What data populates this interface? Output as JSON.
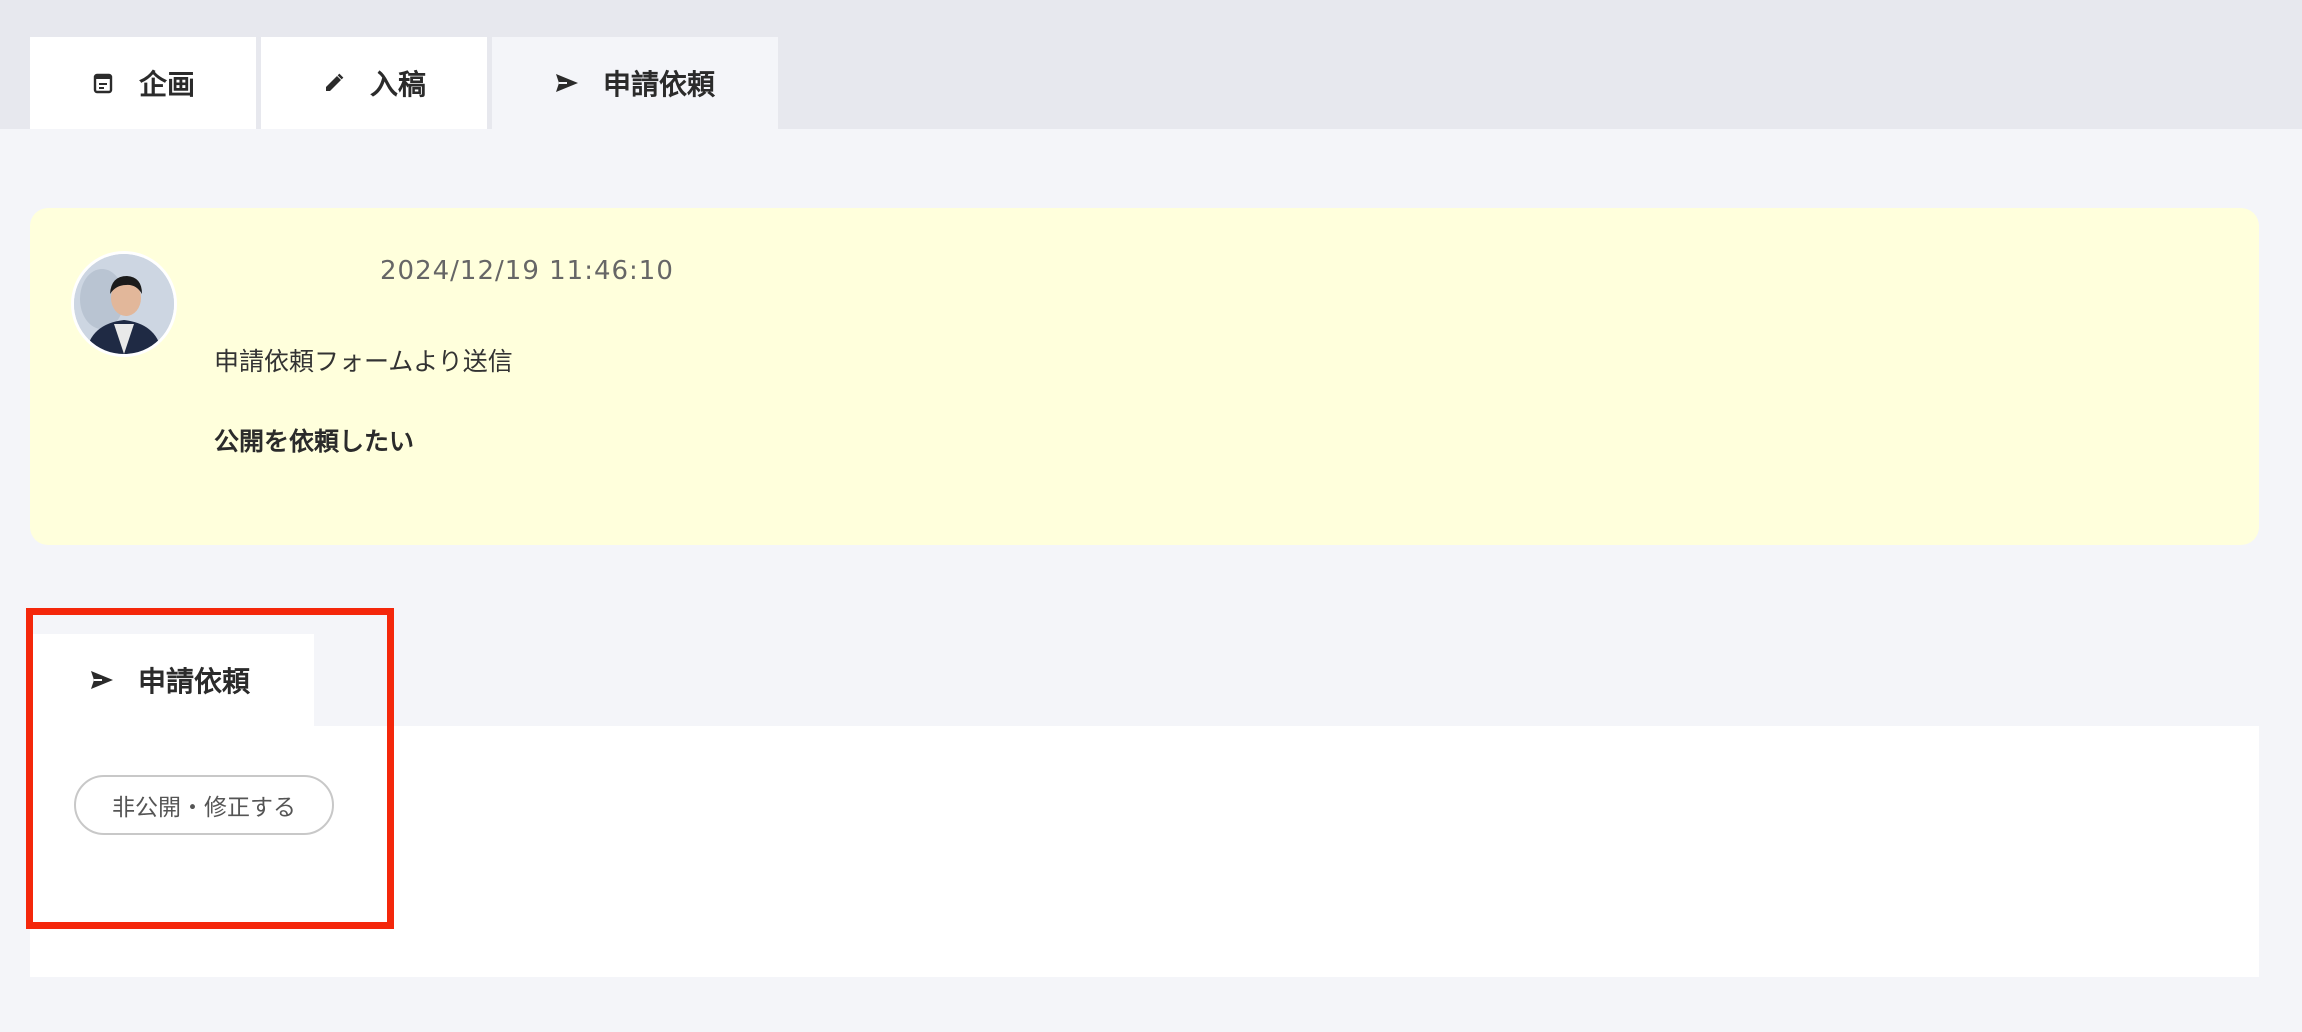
{
  "tabs": [
    {
      "label": "企画",
      "icon": "calendar-icon"
    },
    {
      "label": "入稿",
      "icon": "pencil-icon"
    },
    {
      "label": "申請依頼",
      "icon": "send-icon"
    }
  ],
  "message": {
    "timestamp": "2024/12/19 11:46:10",
    "source": "申請依頼フォームより送信",
    "body": "公開を依頼したい",
    "background_color": "#ffffdc"
  },
  "request_panel": {
    "tab_label": "申請依頼",
    "tab_icon": "send-icon",
    "button_label": "非公開・修正する"
  },
  "highlight": {
    "color": "#f4270b"
  }
}
